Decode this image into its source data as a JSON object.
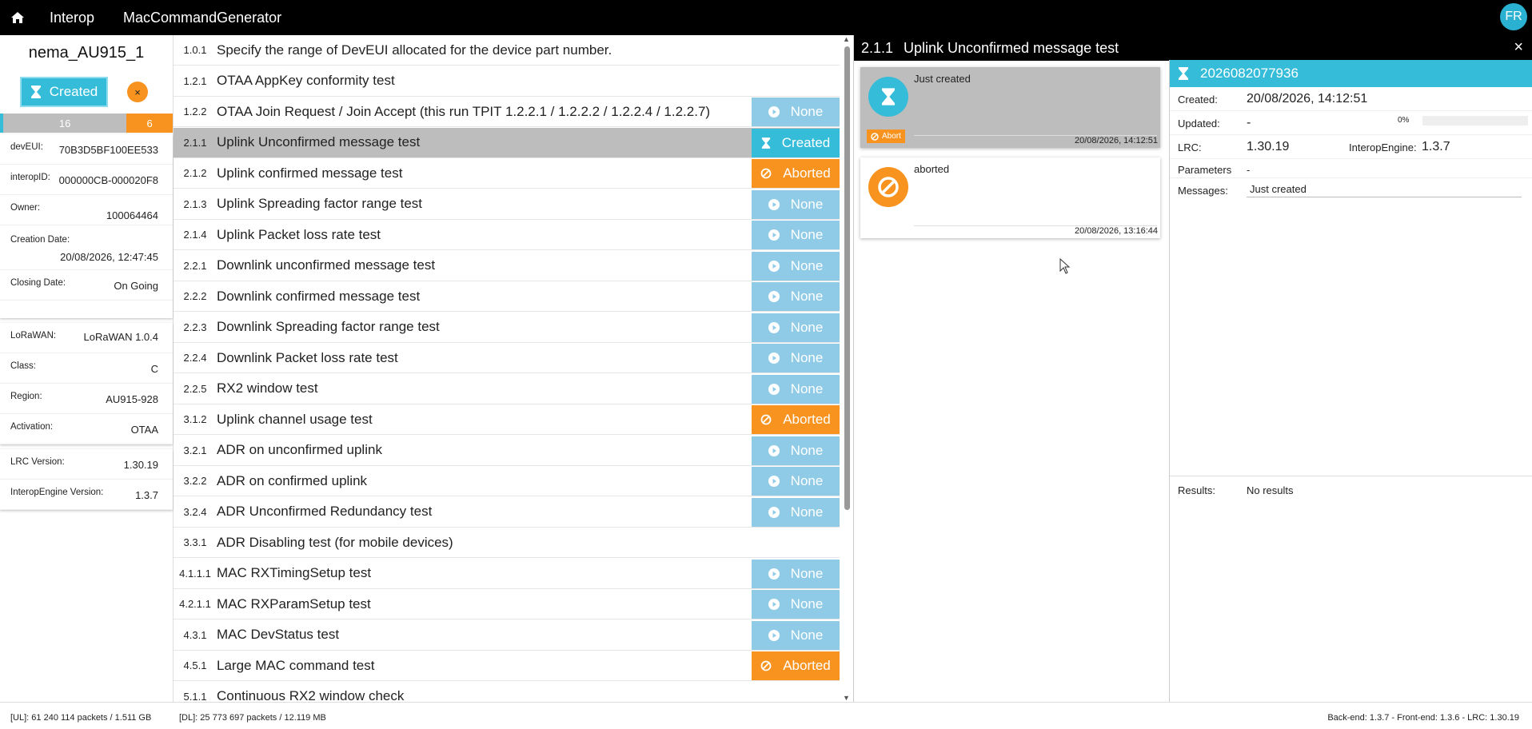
{
  "topbar": {
    "nav": [
      "Interop",
      "MacCommandGenerator"
    ],
    "avatar": "FR"
  },
  "device": {
    "name": "nema_AU915_1",
    "status": "Created",
    "close_symbol": "×",
    "progress": {
      "count_gray": "16",
      "count_orange": "6"
    },
    "fields": [
      {
        "label": "devEUI:",
        "value": "70B3D5BF100EE533"
      },
      {
        "label": "interopID:",
        "value": "000000CB-000020F8"
      },
      {
        "label": "Owner:",
        "value": "100064464"
      },
      {
        "label": "Creation Date:",
        "value": "20/08/2026, 12:47:45"
      },
      {
        "label": "Closing Date:",
        "value": "On Going"
      }
    ],
    "lorawan": [
      {
        "label": "LoRaWAN:",
        "value": "LoRaWAN 1.0.4"
      },
      {
        "label": "Class:",
        "value": "C"
      },
      {
        "label": "Region:",
        "value": "AU915-928"
      },
      {
        "label": "Activation:",
        "value": "OTAA"
      }
    ],
    "versions": [
      {
        "label": "LRC Version:",
        "value": "1.30.19"
      },
      {
        "label": "InteropEngine Version:",
        "value": "1.3.7"
      }
    ]
  },
  "tests": [
    {
      "num": "1.0.1",
      "name": "Specify the range of DevEUI allocated for the device part number.",
      "status": ""
    },
    {
      "num": "1.2.1",
      "name": "OTAA AppKey conformity test",
      "status": ""
    },
    {
      "num": "1.2.2",
      "name": "OTAA Join Request / Join Accept (this run TPIT 1.2.2.1 / 1.2.2.2 / 1.2.2.4 / 1.2.2.7)",
      "status": "None"
    },
    {
      "num": "2.1.1",
      "name": "Uplink Unconfirmed message test",
      "status": "Created",
      "selected": true
    },
    {
      "num": "2.1.2",
      "name": "Uplink confirmed message test",
      "status": "Aborted"
    },
    {
      "num": "2.1.3",
      "name": "Uplink Spreading factor range test",
      "status": "None"
    },
    {
      "num": "2.1.4",
      "name": "Uplink Packet loss rate test",
      "status": "None"
    },
    {
      "num": "2.2.1",
      "name": "Downlink unconfirmed message test",
      "status": "None"
    },
    {
      "num": "2.2.2",
      "name": "Downlink confirmed message test",
      "status": "None"
    },
    {
      "num": "2.2.3",
      "name": "Downlink Spreading factor range test",
      "status": "None"
    },
    {
      "num": "2.2.4",
      "name": "Downlink Packet loss rate test",
      "status": "None"
    },
    {
      "num": "2.2.5",
      "name": "RX2 window test",
      "status": "None"
    },
    {
      "num": "3.1.2",
      "name": "Uplink channel usage test",
      "status": "Aborted"
    },
    {
      "num": "3.2.1",
      "name": "ADR on unconfirmed uplink",
      "status": "None"
    },
    {
      "num": "3.2.2",
      "name": "ADR on confirmed uplink",
      "status": "None"
    },
    {
      "num": "3.2.4",
      "name": "ADR Unconfirmed Redundancy test",
      "status": "None"
    },
    {
      "num": "3.3.1",
      "name": "ADR Disabling test (for mobile devices)",
      "status": ""
    },
    {
      "num": "4.1.1.1",
      "name": "MAC RXTimingSetup test",
      "status": "None"
    },
    {
      "num": "4.2.1.1",
      "name": "MAC RXParamSetup test",
      "status": "None"
    },
    {
      "num": "4.3.1",
      "name": "MAC DevStatus test",
      "status": "None"
    },
    {
      "num": "4.5.1",
      "name": "Large MAC command test",
      "status": "Aborted"
    },
    {
      "num": "5.1.1",
      "name": "Continuous RX2 window check",
      "status": ""
    }
  ],
  "detail": {
    "num": "2.1.1",
    "title": "Uplink Unconfirmed message test",
    "close": "×",
    "history": [
      {
        "message": "Just created",
        "date": "20/08/2026, 14:12:51",
        "abort_label": "Abort",
        "type": "created"
      },
      {
        "message": "aborted",
        "date": "20/08/2026, 13:16:44",
        "type": "aborted"
      }
    ],
    "run": {
      "id": "2026082077936",
      "created_label": "Created:",
      "created": "20/08/2026, 14:12:51",
      "updated_label": "Updated:",
      "updated": "-",
      "percent": "0%",
      "progress": 0,
      "lrc_label": "LRC:",
      "lrc": "1.30.19",
      "ie_label": "InteropEngine:",
      "ie": "1.3.7",
      "params_label": "Parameters",
      "params": "-",
      "messages_label": "Messages:",
      "messages": "Just created",
      "results_label": "Results:",
      "results": "No results"
    }
  },
  "footer": {
    "ul": "[UL]: 61 240 114 packets / 1.511 GB",
    "dl": "[DL]: 25 773 697 packets / 12.119 MB",
    "versions": "Back-end: 1.3.7 - Front-end: 1.3.6 - LRC: 1.30.19"
  },
  "colors": {
    "created": "#35bcd9",
    "none": "#8fcbe6",
    "aborted": "#f7931e",
    "selected_row": "#bdbdbd"
  },
  "icons": {
    "home": "home-icon",
    "hourglass": "hourglass-icon",
    "play": "play-icon",
    "ban": "ban-icon"
  }
}
